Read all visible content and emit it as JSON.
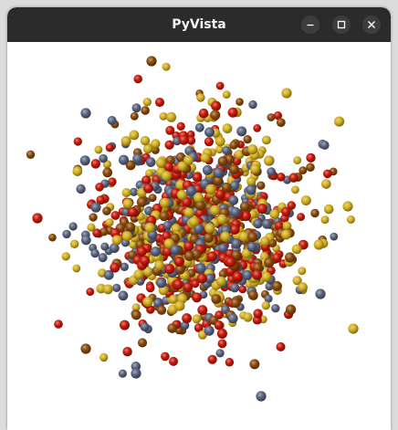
{
  "window": {
    "title": "PyVista",
    "controls": {
      "minimize_icon": "minimize-icon",
      "maximize_icon": "maximize-icon",
      "close_icon": "close-icon"
    }
  },
  "scene": {
    "background": "#ffffff",
    "sphere_colors": {
      "red": "#c81808",
      "gold": "#d4b020",
      "slate": "#5a6480",
      "brown": "#8a4a08"
    }
  }
}
